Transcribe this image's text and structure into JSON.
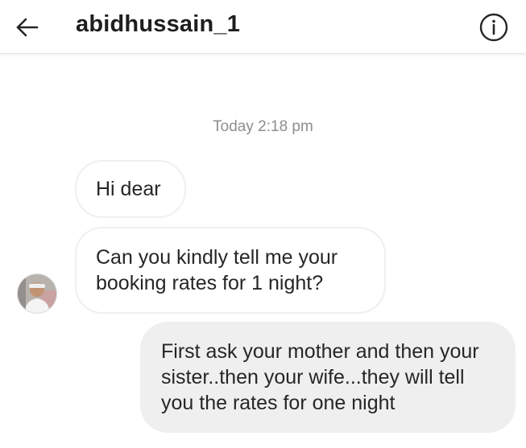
{
  "header": {
    "username": "abidhussain_1",
    "back_icon": "arrow-left-icon",
    "info_icon": "info-circle-icon"
  },
  "thread": {
    "timestamp": "Today 2:18 pm",
    "messages": [
      {
        "direction": "incoming",
        "text": "Hi dear"
      },
      {
        "direction": "incoming",
        "text": "Can you kindly tell me your booking rates for 1 night?"
      },
      {
        "direction": "outgoing",
        "text": "First ask your mother and then your sister..then your wife...they will tell you the rates for one night"
      }
    ]
  },
  "colors": {
    "incoming_bubble_bg": "#ffffff",
    "incoming_bubble_border": "#efefef",
    "outgoing_bubble_bg": "#efefef",
    "timestamp": "#8e8e8e"
  }
}
